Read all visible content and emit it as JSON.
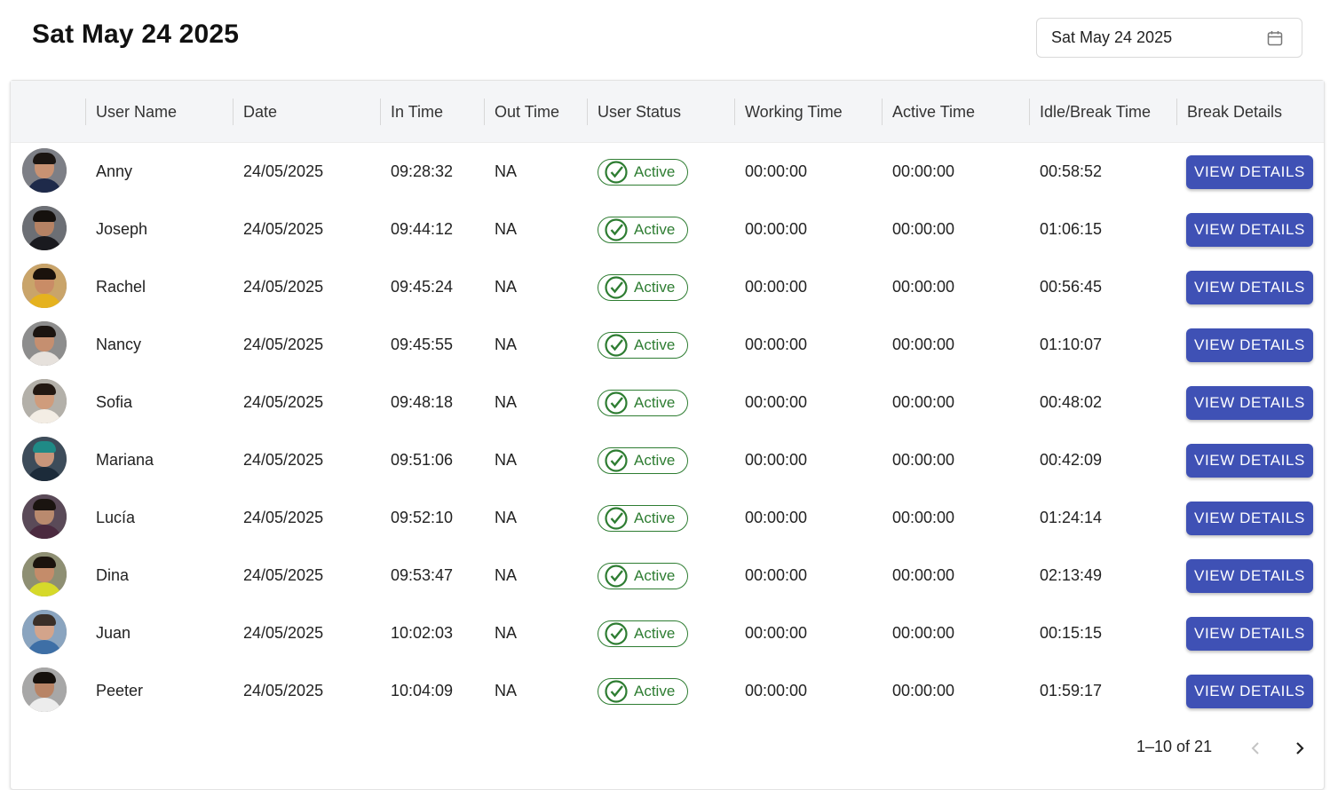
{
  "header": {
    "title": "Sat May 24 2025",
    "date_picker_value": "Sat May 24 2025",
    "date_picker_icon": "calendar-icon"
  },
  "table": {
    "columns": [
      "",
      "User Name",
      "Date",
      "In Time",
      "Out Time",
      "User Status",
      "Working Time",
      "Active Time",
      "Idle/Break Time",
      "Break Details"
    ],
    "rows": [
      {
        "name": "Anny",
        "date": "24/05/2025",
        "in_time": "09:28:32",
        "out_time": "NA",
        "status": "Active",
        "working_time": "00:00:00",
        "active_time": "00:00:00",
        "idle_time": "00:58:52",
        "action": "VIEW DETAILS"
      },
      {
        "name": "Joseph",
        "date": "24/05/2025",
        "in_time": "09:44:12",
        "out_time": "NA",
        "status": "Active",
        "working_time": "00:00:00",
        "active_time": "00:00:00",
        "idle_time": "01:06:15",
        "action": "VIEW DETAILS"
      },
      {
        "name": "Rachel",
        "date": "24/05/2025",
        "in_time": "09:45:24",
        "out_time": "NA",
        "status": "Active",
        "working_time": "00:00:00",
        "active_time": "00:00:00",
        "idle_time": "00:56:45",
        "action": "VIEW DETAILS"
      },
      {
        "name": "Nancy",
        "date": "24/05/2025",
        "in_time": "09:45:55",
        "out_time": "NA",
        "status": "Active",
        "working_time": "00:00:00",
        "active_time": "00:00:00",
        "idle_time": "01:10:07",
        "action": "VIEW DETAILS"
      },
      {
        "name": "Sofia",
        "date": "24/05/2025",
        "in_time": "09:48:18",
        "out_time": "NA",
        "status": "Active",
        "working_time": "00:00:00",
        "active_time": "00:00:00",
        "idle_time": "00:48:02",
        "action": "VIEW DETAILS"
      },
      {
        "name": "Mariana",
        "date": "24/05/2025",
        "in_time": "09:51:06",
        "out_time": "NA",
        "status": "Active",
        "working_time": "00:00:00",
        "active_time": "00:00:00",
        "idle_time": "00:42:09",
        "action": "VIEW DETAILS"
      },
      {
        "name": "Lucía",
        "date": "24/05/2025",
        "in_time": "09:52:10",
        "out_time": "NA",
        "status": "Active",
        "working_time": "00:00:00",
        "active_time": "00:00:00",
        "idle_time": "01:24:14",
        "action": "VIEW DETAILS"
      },
      {
        "name": "Dina",
        "date": "24/05/2025",
        "in_time": "09:53:47",
        "out_time": "NA",
        "status": "Active",
        "working_time": "00:00:00",
        "active_time": "00:00:00",
        "idle_time": "02:13:49",
        "action": "VIEW DETAILS"
      },
      {
        "name": "Juan",
        "date": "24/05/2025",
        "in_time": "10:02:03",
        "out_time": "NA",
        "status": "Active",
        "working_time": "00:00:00",
        "active_time": "00:00:00",
        "idle_time": "00:15:15",
        "action": "VIEW DETAILS"
      },
      {
        "name": "Peeter",
        "date": "24/05/2025",
        "in_time": "10:04:09",
        "out_time": "NA",
        "status": "Active",
        "working_time": "00:00:00",
        "active_time": "00:00:00",
        "idle_time": "01:59:17",
        "action": "VIEW DETAILS"
      }
    ]
  },
  "pagination": {
    "range_text": "1–10 of 21",
    "prev_icon": "chevron-left-icon",
    "next_icon": "chevron-right-icon",
    "prev_enabled": false,
    "next_enabled": true
  },
  "colors": {
    "accent": "#3f51b5",
    "status_active": "#2e7d32",
    "header_bg": "#f4f5f7"
  }
}
